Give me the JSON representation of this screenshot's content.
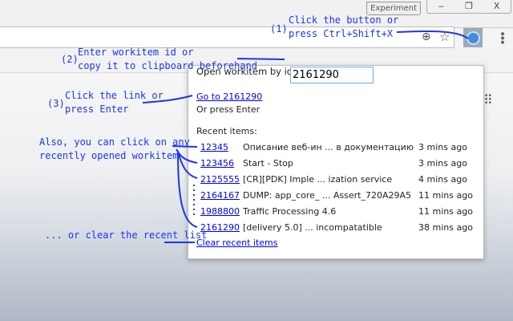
{
  "browser": {
    "experiment_label": "Experiment",
    "minimize": "‒",
    "restore": "❐",
    "close": "X"
  },
  "popup": {
    "open_label": "Open workitem by id:",
    "id_value": "2161290",
    "goto_link": "Go to 2161290",
    "or_enter": "Or press Enter",
    "recent_title": "Recent items:",
    "recent": [
      {
        "id": "12345",
        "title": "Описание веб-ин ... в документацию",
        "ago": "3 mins ago"
      },
      {
        "id": "123456",
        "title": "Start - Stop",
        "ago": "3 mins ago"
      },
      {
        "id": "2125555",
        "title": "[CR][PDK] Imple ... ization service",
        "ago": "4 mins ago"
      },
      {
        "id": "2164167",
        "title": "DUMP: app_core_ ... Assert_720A29A5",
        "ago": "11 mins ago"
      },
      {
        "id": "1988800",
        "title": "Traffic Processing 4.6",
        "ago": "11 mins ago"
      },
      {
        "id": "2161290",
        "title": "[delivery 5.0] ... incompatatible",
        "ago": "38 mins ago"
      }
    ],
    "clear_link": "Clear recent items"
  },
  "annotations": {
    "step1_num": "(1)",
    "step1": "Click the button or\npress Ctrl+Shift+X",
    "step2_num": "(2)",
    "step2": "Enter workitem id or\ncopy it to clipboard beforehand",
    "step3_num": "(3)",
    "step3": "Click the link or\npress Enter",
    "recent": "Also, you can click on any\nrecently opened workitem",
    "clear": "... or clear the recent list"
  },
  "colors": {
    "annotation": "#1a36f0",
    "link": "#0000ee"
  }
}
